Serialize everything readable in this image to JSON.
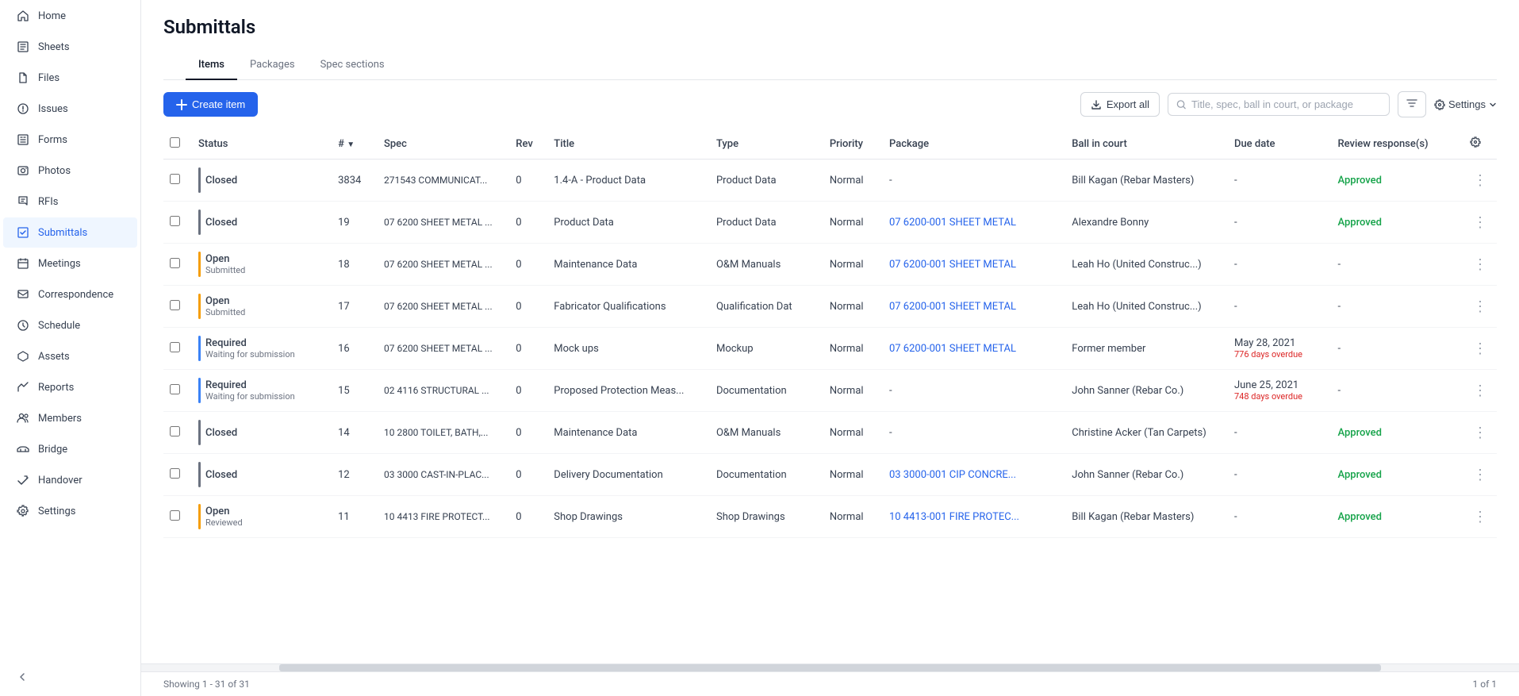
{
  "sidebar": {
    "items": [
      {
        "id": "home",
        "label": "Home",
        "active": false
      },
      {
        "id": "sheets",
        "label": "Sheets",
        "active": false
      },
      {
        "id": "files",
        "label": "Files",
        "active": false
      },
      {
        "id": "issues",
        "label": "Issues",
        "active": false
      },
      {
        "id": "forms",
        "label": "Forms",
        "active": false
      },
      {
        "id": "photos",
        "label": "Photos",
        "active": false
      },
      {
        "id": "rfis",
        "label": "RFIs",
        "active": false
      },
      {
        "id": "submittals",
        "label": "Submittals",
        "active": true
      },
      {
        "id": "meetings",
        "label": "Meetings",
        "active": false
      },
      {
        "id": "correspondence",
        "label": "Correspondence",
        "active": false
      },
      {
        "id": "schedule",
        "label": "Schedule",
        "active": false
      },
      {
        "id": "assets",
        "label": "Assets",
        "active": false
      },
      {
        "id": "reports",
        "label": "Reports",
        "active": false
      },
      {
        "id": "members",
        "label": "Members",
        "active": false
      },
      {
        "id": "bridge",
        "label": "Bridge",
        "active": false
      },
      {
        "id": "handover",
        "label": "Handover",
        "active": false
      },
      {
        "id": "settings",
        "label": "Settings",
        "active": false
      }
    ]
  },
  "page": {
    "title": "Submittals",
    "tabs": [
      {
        "id": "items",
        "label": "Items",
        "active": true
      },
      {
        "id": "packages",
        "label": "Packages",
        "active": false
      },
      {
        "id": "spec-sections",
        "label": "Spec sections",
        "active": false
      }
    ],
    "create_button": "Create item",
    "export_button": "Export all",
    "search_placeholder": "Title, spec, ball in court, or package",
    "settings_button": "Settings",
    "footer_showing": "Showing 1 - 31 of 31",
    "footer_page": "1 of 1"
  },
  "table": {
    "columns": [
      "Status",
      "#",
      "Spec",
      "Rev",
      "Title",
      "Type",
      "Priority",
      "Package",
      "Ball in court",
      "Due date",
      "Review response(s)"
    ],
    "rows": [
      {
        "status_main": "Closed",
        "status_sub": "",
        "status_type": "closed",
        "num": "3834",
        "spec": "271543 COMMUNICAT...",
        "rev": "0",
        "title": "1.4-A - Product Data",
        "type": "Product Data",
        "priority": "Normal",
        "package": "-",
        "ball_in_court": "Bill Kagan (Rebar Masters)",
        "due_date": "-",
        "review": "Approved",
        "review_class": "approved"
      },
      {
        "status_main": "Closed",
        "status_sub": "",
        "status_type": "closed",
        "num": "19",
        "spec": "07 6200 SHEET METAL ...",
        "rev": "0",
        "title": "Product Data",
        "type": "Product Data",
        "priority": "Normal",
        "package": "07 6200-001 SHEET METAL",
        "package_link": true,
        "ball_in_court": "Alexandre Bonny",
        "due_date": "-",
        "review": "Approved",
        "review_class": "approved"
      },
      {
        "status_main": "Open",
        "status_sub": "Submitted",
        "status_type": "open-submitted",
        "num": "18",
        "spec": "07 6200 SHEET METAL ...",
        "rev": "0",
        "title": "Maintenance Data",
        "type": "O&M Manuals",
        "priority": "Normal",
        "package": "07 6200-001 SHEET METAL",
        "package_link": true,
        "ball_in_court": "Leah Ho (United Construc...)",
        "due_date": "-",
        "review": "-",
        "review_class": ""
      },
      {
        "status_main": "Open",
        "status_sub": "Submitted",
        "status_type": "open-submitted",
        "num": "17",
        "spec": "07 6200 SHEET METAL ...",
        "rev": "0",
        "title": "Fabricator Qualifications",
        "type": "Qualification Dat",
        "priority": "Normal",
        "package": "07 6200-001 SHEET METAL",
        "package_link": true,
        "ball_in_court": "Leah Ho (United Construc...)",
        "due_date": "-",
        "review": "-",
        "review_class": ""
      },
      {
        "status_main": "Required",
        "status_sub": "Waiting for submission",
        "status_type": "required",
        "num": "16",
        "spec": "07 6200 SHEET METAL ...",
        "rev": "0",
        "title": "Mock ups",
        "type": "Mockup",
        "priority": "Normal",
        "package": "07 6200-001 SHEET METAL",
        "package_link": true,
        "ball_in_court": "Former member",
        "due_date": "May 28, 2021",
        "due_overdue": "776 days overdue",
        "review": "-",
        "review_class": ""
      },
      {
        "status_main": "Required",
        "status_sub": "Waiting for submission",
        "status_type": "required",
        "num": "15",
        "spec": "02 4116 STRUCTURAL ...",
        "rev": "0",
        "title": "Proposed Protection Meas...",
        "type": "Documentation",
        "priority": "Normal",
        "package": "-",
        "ball_in_court": "John Sanner (Rebar Co.)",
        "due_date": "June 25, 2021",
        "due_overdue": "748 days overdue",
        "review": "-",
        "review_class": ""
      },
      {
        "status_main": "Closed",
        "status_sub": "",
        "status_type": "closed",
        "num": "14",
        "spec": "10 2800 TOILET, BATH,...",
        "rev": "0",
        "title": "Maintenance Data",
        "type": "O&M Manuals",
        "priority": "Normal",
        "package": "-",
        "ball_in_court": "Christine Acker (Tan Carpets)",
        "due_date": "-",
        "review": "Approved",
        "review_class": "approved"
      },
      {
        "status_main": "Closed",
        "status_sub": "",
        "status_type": "closed",
        "num": "12",
        "spec": "03 3000 CAST-IN-PLAC...",
        "rev": "0",
        "title": "Delivery Documentation",
        "type": "Documentation",
        "priority": "Normal",
        "package": "03 3000-001 CIP CONCRE...",
        "package_link": true,
        "ball_in_court": "John Sanner (Rebar Co.)",
        "due_date": "-",
        "review": "Approved",
        "review_class": "approved"
      },
      {
        "status_main": "Open",
        "status_sub": "Reviewed",
        "status_type": "open-reviewed",
        "num": "11",
        "spec": "10 4413 FIRE PROTECT...",
        "rev": "0",
        "title": "Shop Drawings",
        "type": "Shop Drawings",
        "priority": "Normal",
        "package": "10 4413-001 FIRE PROTEC...",
        "package_link": true,
        "ball_in_court": "Bill Kagan (Rebar Masters)",
        "due_date": "-",
        "review": "Approved",
        "review_class": "approved"
      }
    ]
  }
}
